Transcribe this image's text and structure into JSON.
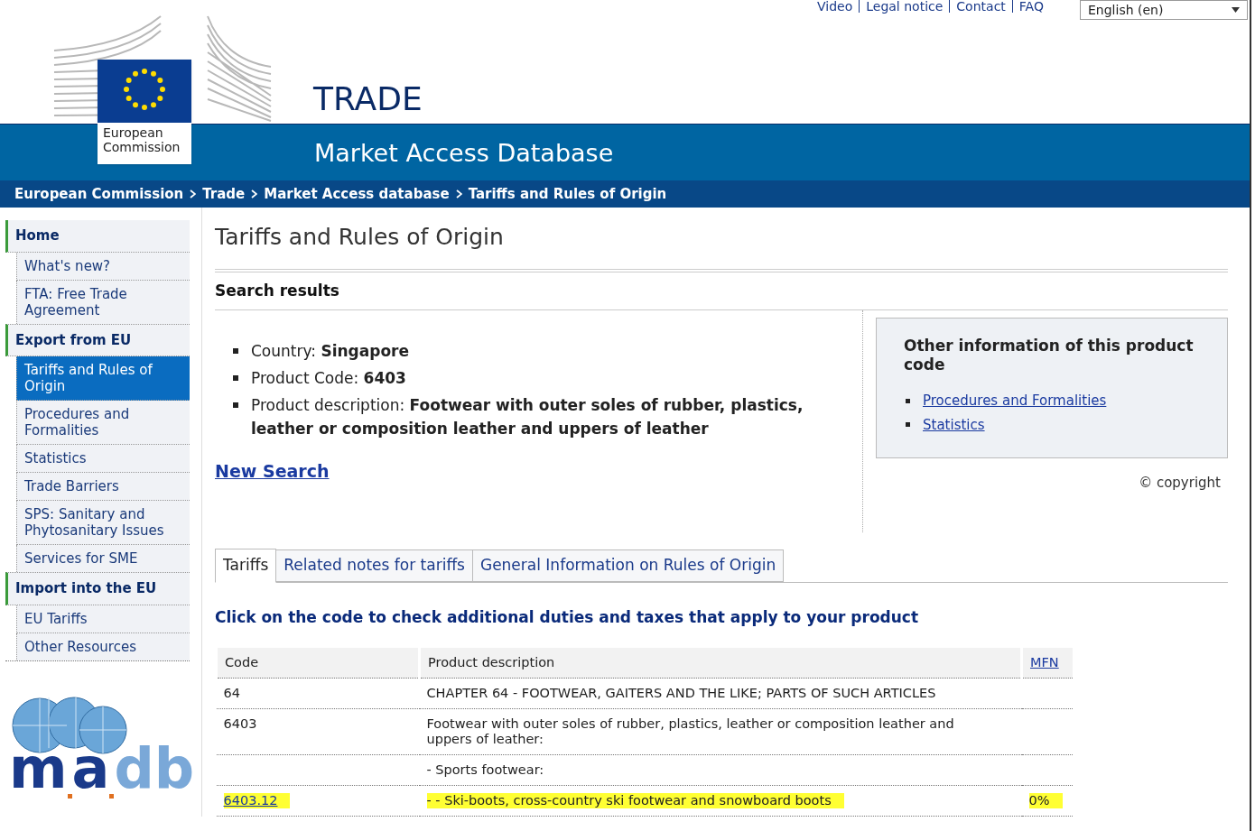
{
  "top_links": [
    "Video",
    "Legal notice",
    "Contact",
    "FAQ"
  ],
  "language_select": {
    "value": "English (en)"
  },
  "logo": {
    "text": "European Commission"
  },
  "header": {
    "title": "TRADE",
    "subtitle": "Market Access Database"
  },
  "breadcrumb": [
    "European Commission",
    "Trade",
    "Market Access database",
    "Tariffs and Rules of Origin"
  ],
  "sidebar": {
    "items": [
      {
        "label": "Home",
        "children": [
          {
            "label": "What's new?",
            "selected": false
          },
          {
            "label": "FTA: Free Trade Agreement",
            "selected": false
          }
        ]
      },
      {
        "label": "Export from EU",
        "children": [
          {
            "label": "Tariffs and Rules of Origin",
            "selected": true
          },
          {
            "label": "Procedures and Formalities",
            "selected": false
          },
          {
            "label": "Statistics",
            "selected": false
          },
          {
            "label": "Trade Barriers",
            "selected": false
          },
          {
            "label": "SPS: Sanitary and Phytosanitary Issues",
            "selected": false
          },
          {
            "label": "Services for SME",
            "selected": false
          }
        ]
      },
      {
        "label": "Import into the EU",
        "children": [
          {
            "label": "EU Tariffs",
            "selected": false
          },
          {
            "label": "Other Resources",
            "selected": false
          }
        ]
      }
    ]
  },
  "madb_logo": {
    "parts": [
      "m",
      "a",
      "db"
    ]
  },
  "page_title": "Tariffs and Rules of Origin",
  "section_title": "Search results",
  "criteria": [
    {
      "label": "Country:",
      "value": "Singapore"
    },
    {
      "label": "Product Code:",
      "value": "6403"
    },
    {
      "label": "Product description:",
      "value": "Footwear with outer soles of rubber, plastics, leather or composition leather and uppers of leather"
    }
  ],
  "new_search": "New Search",
  "info_box": {
    "title": "Other information of this product code",
    "links": [
      "Procedures and Formalities",
      "Statistics"
    ]
  },
  "copyright": "© copyright",
  "tabs": [
    {
      "label": "Tariffs",
      "selected": true
    },
    {
      "label": "Related notes for tariffs",
      "selected": false
    },
    {
      "label": "General Information on Rules of Origin",
      "selected": false
    }
  ],
  "instruction": "Click on the code to check additional duties and taxes that apply to your product",
  "table": {
    "columns": [
      "Code",
      "Product description",
      "MFN"
    ],
    "rows": [
      {
        "code": "64",
        "description": "CHAPTER 64 - FOOTWEAR, GAITERS AND THE LIKE; PARTS OF SUCH ARTICLES",
        "highlighted": false
      },
      {
        "code": "6403",
        "description": "Footwear with outer soles of rubber, plastics, leather or composition leather and uppers of leather:",
        "highlighted": false
      },
      {
        "description": "- Sports footwear:",
        "highlighted": false
      },
      {
        "code": "6403.12",
        "description": "- - Ski-boots, cross-country ski footwear and snowboard boots",
        "mfn": "0%",
        "highlighted": true,
        "link": true
      }
    ]
  }
}
